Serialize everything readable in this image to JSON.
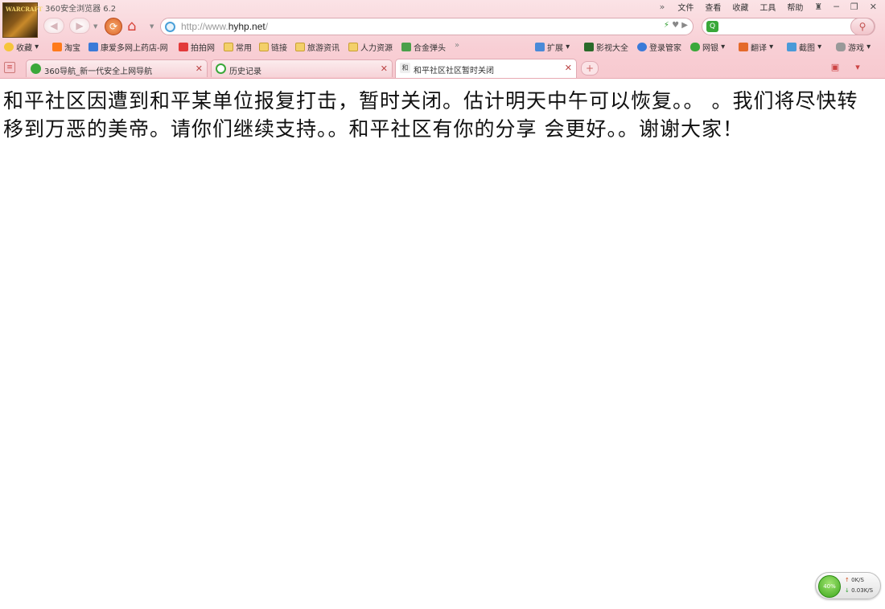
{
  "app": {
    "title": "360安全浏览器 6.2"
  },
  "menu": [
    "文件",
    "查看",
    "收藏",
    "工具",
    "帮助"
  ],
  "address": {
    "prefix": "http://www.",
    "domain": "hyhp.net",
    "suffix": "/"
  },
  "bookmarks": {
    "favorites": "收藏",
    "items": [
      "淘宝",
      "康爱多网上药店-网",
      "拍拍网",
      "常用",
      "链接",
      "旅游资讯",
      "人力资源",
      "合金弹头"
    ],
    "right_items": [
      "扩展",
      "影视大全",
      "登录管家",
      "网银",
      "翻译",
      "截图",
      "游戏"
    ]
  },
  "tabs": [
    {
      "title": "360导航_新一代安全上网导航",
      "active": false
    },
    {
      "title": "历史记录",
      "active": false
    },
    {
      "title": "和平社区社区暂时关闭",
      "active": true
    }
  ],
  "page": {
    "notice": "和平社区因遭到和平某单位报复打击，暂时关闭。估计明天中午可以恢复。。  。我们将尽快转移到万恶的美帝。请你们继续支持。。和平社区有你的分享 会更好。。谢谢大家！"
  },
  "speed_widget": {
    "percent": "40%",
    "upload": "0K/S",
    "download": "0.03K/S"
  },
  "colors": {
    "chrome_pink": "#f8cfd5",
    "border_pink": "#e7a9b2",
    "speed_green": "#3ea81e"
  }
}
